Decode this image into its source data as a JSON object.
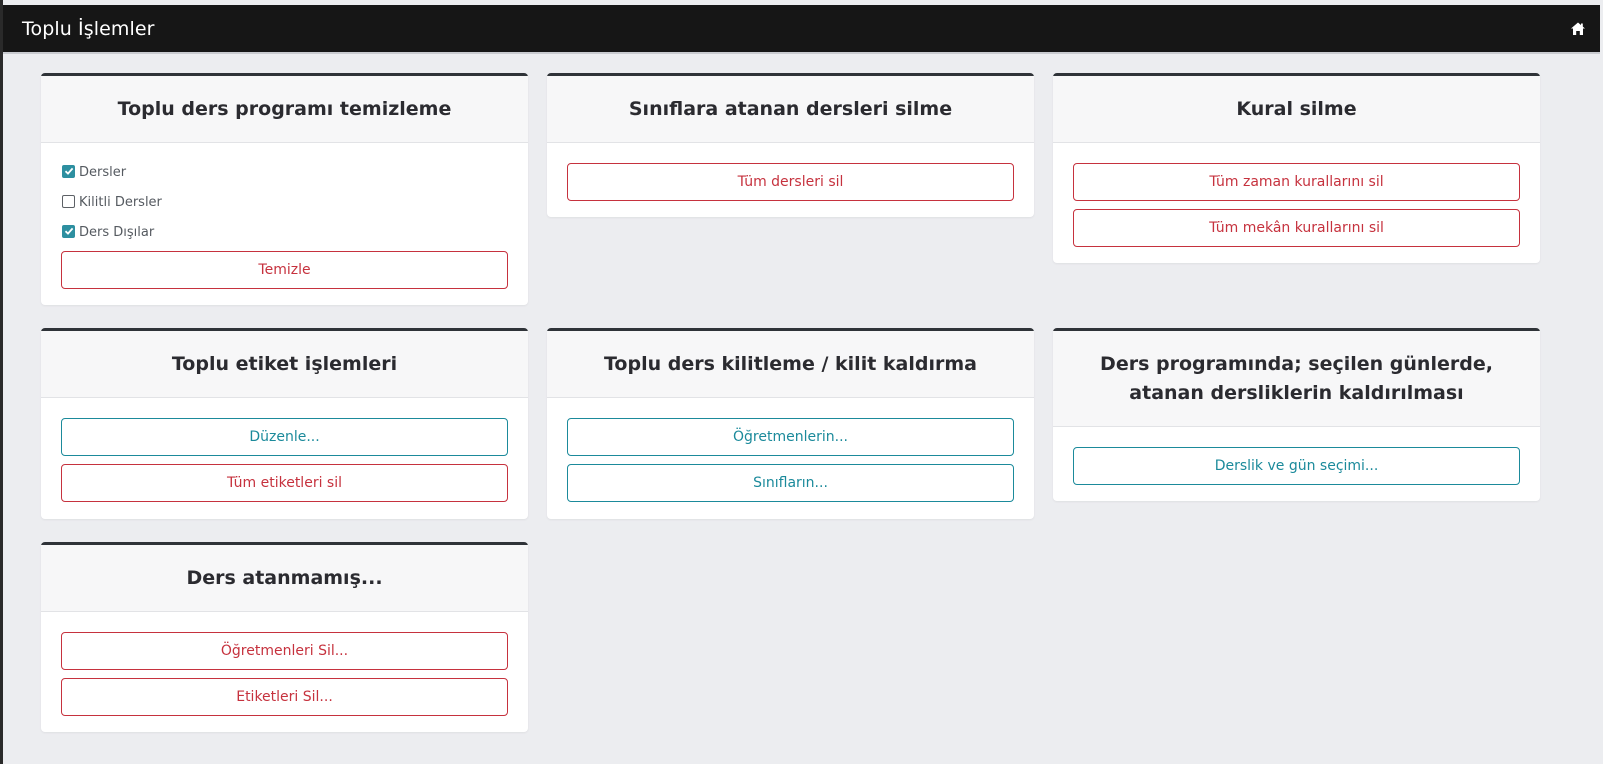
{
  "app": {
    "title": "Toplu İşlemler",
    "home_icon": "home-icon"
  },
  "cards": {
    "clear_schedule": {
      "title": "Toplu ders programı temizleme",
      "options": [
        {
          "label": "Dersler",
          "checked": true
        },
        {
          "label": "Kilitli Dersler",
          "checked": false
        },
        {
          "label": "Ders Dışılar",
          "checked": true
        }
      ],
      "button": "Temizle"
    },
    "delete_class_lessons": {
      "title": "Sınıflara atanan dersleri silme",
      "button": "Tüm dersleri sil"
    },
    "delete_rules": {
      "title": "Kural silme",
      "buttons": [
        "Tüm zaman kurallarını sil",
        "Tüm mekân kurallarını sil"
      ]
    },
    "tags": {
      "title": "Toplu etiket işlemleri",
      "buttons": [
        "Düzenle...",
        "Tüm etiketleri sil"
      ]
    },
    "lock": {
      "title": "Toplu ders kilitleme / kilit kaldırma",
      "buttons": [
        "Öğretmenlerin...",
        "Sınıfların..."
      ]
    },
    "remove_rooms": {
      "title": "Ders programında; seçilen günlerde, atanan dersliklerin kaldırılması",
      "button": "Derslik ve gün seçimi..."
    },
    "unassigned": {
      "title": "Ders atanmamış...",
      "buttons": [
        "Öğretmenleri Sil...",
        "Etiketleri Sil..."
      ]
    }
  },
  "colors": {
    "topbar": "#161616",
    "background": "#ecedf0",
    "danger": "#c6323e",
    "info": "#1b8a9b",
    "checkbox": "#2d8fa0"
  }
}
